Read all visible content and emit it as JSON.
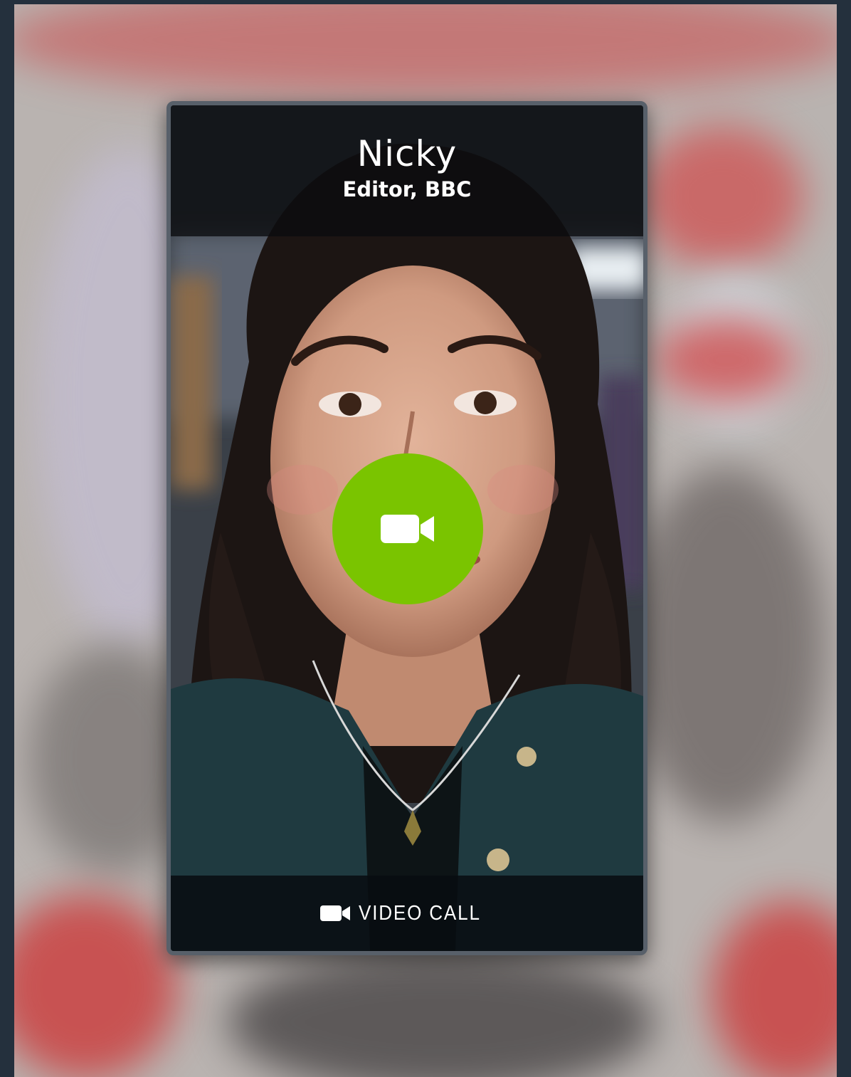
{
  "caller": {
    "name": "Nicky",
    "title": "Editor, BBC"
  },
  "actions": {
    "answer_icon": "video-camera-icon",
    "footer_icon": "video-camera-icon",
    "footer_label": "VIDEO CALL"
  },
  "colors": {
    "accept": "#7ac400",
    "page_background": "#24303d",
    "overlay": "#0a0c0e"
  }
}
